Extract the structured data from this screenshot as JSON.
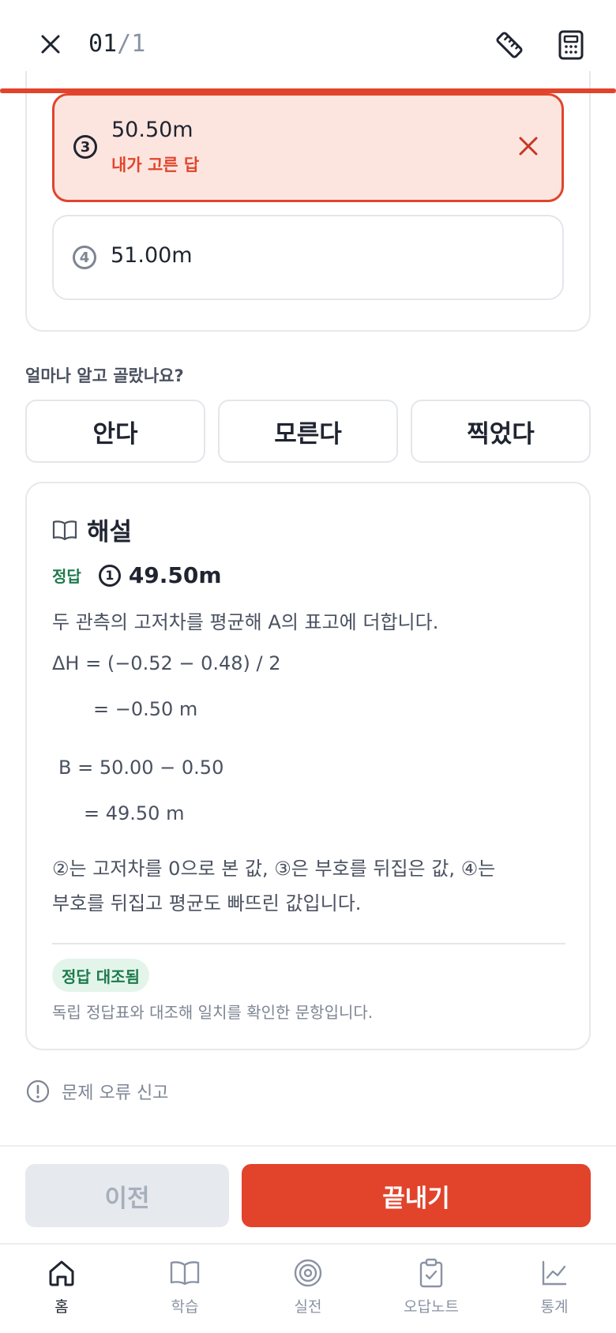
{
  "header": {
    "counter_current": "01",
    "counter_sep": "/",
    "counter_total": "1",
    "progress_fraction": 1.0
  },
  "options": [
    {
      "number": "③",
      "text": "50.50m",
      "sub": "내가 고른 답",
      "state": "wrong-selected"
    },
    {
      "number": "④",
      "text": "51.00m",
      "state": "plain"
    }
  ],
  "confidence": {
    "label": "얼마나 알고 골랐나요?",
    "choices": [
      "안다",
      "모른다",
      "찍었다"
    ]
  },
  "explanation": {
    "title": "해설",
    "answer_label": "정답",
    "answer_number": "1",
    "answer_text": "49.50m",
    "lines": [
      "두 관측의 고저차를 평균해 A의 표고에 더합니다.",
      "ΔH  = (−0.52 − 0.48) / 2",
      "= −0.50 m",
      "B  = 50.00 − 0.50",
      "= 49.50 m",
      "②는 고저차를 0으로 본 값, ③은 부호를 뒤집은 값, ④는",
      "부호를 뒤집고 평균도 빠뜨린 값입니다."
    ],
    "verified_badge": "정답 대조됨",
    "verified_text": "독립 정답표와 대조해 일치를 확인한 문항입니다."
  },
  "report": {
    "label": "문제 오류 신고"
  },
  "actions": {
    "prev_label": "이전",
    "finish_label": "끝내기"
  },
  "tabs": [
    {
      "label": "홈",
      "icon": "home-icon",
      "active": true
    },
    {
      "label": "학습",
      "icon": "book-icon",
      "active": false
    },
    {
      "label": "실전",
      "icon": "target-icon",
      "active": false
    },
    {
      "label": "오답노트",
      "icon": "clipboard-check-icon",
      "active": false
    },
    {
      "label": "통계",
      "icon": "chart-line-icon",
      "active": false
    }
  ],
  "colors": {
    "accent": "#e2432b",
    "correct": "#1f7a4d",
    "wrong_bg": "#fde5df"
  }
}
